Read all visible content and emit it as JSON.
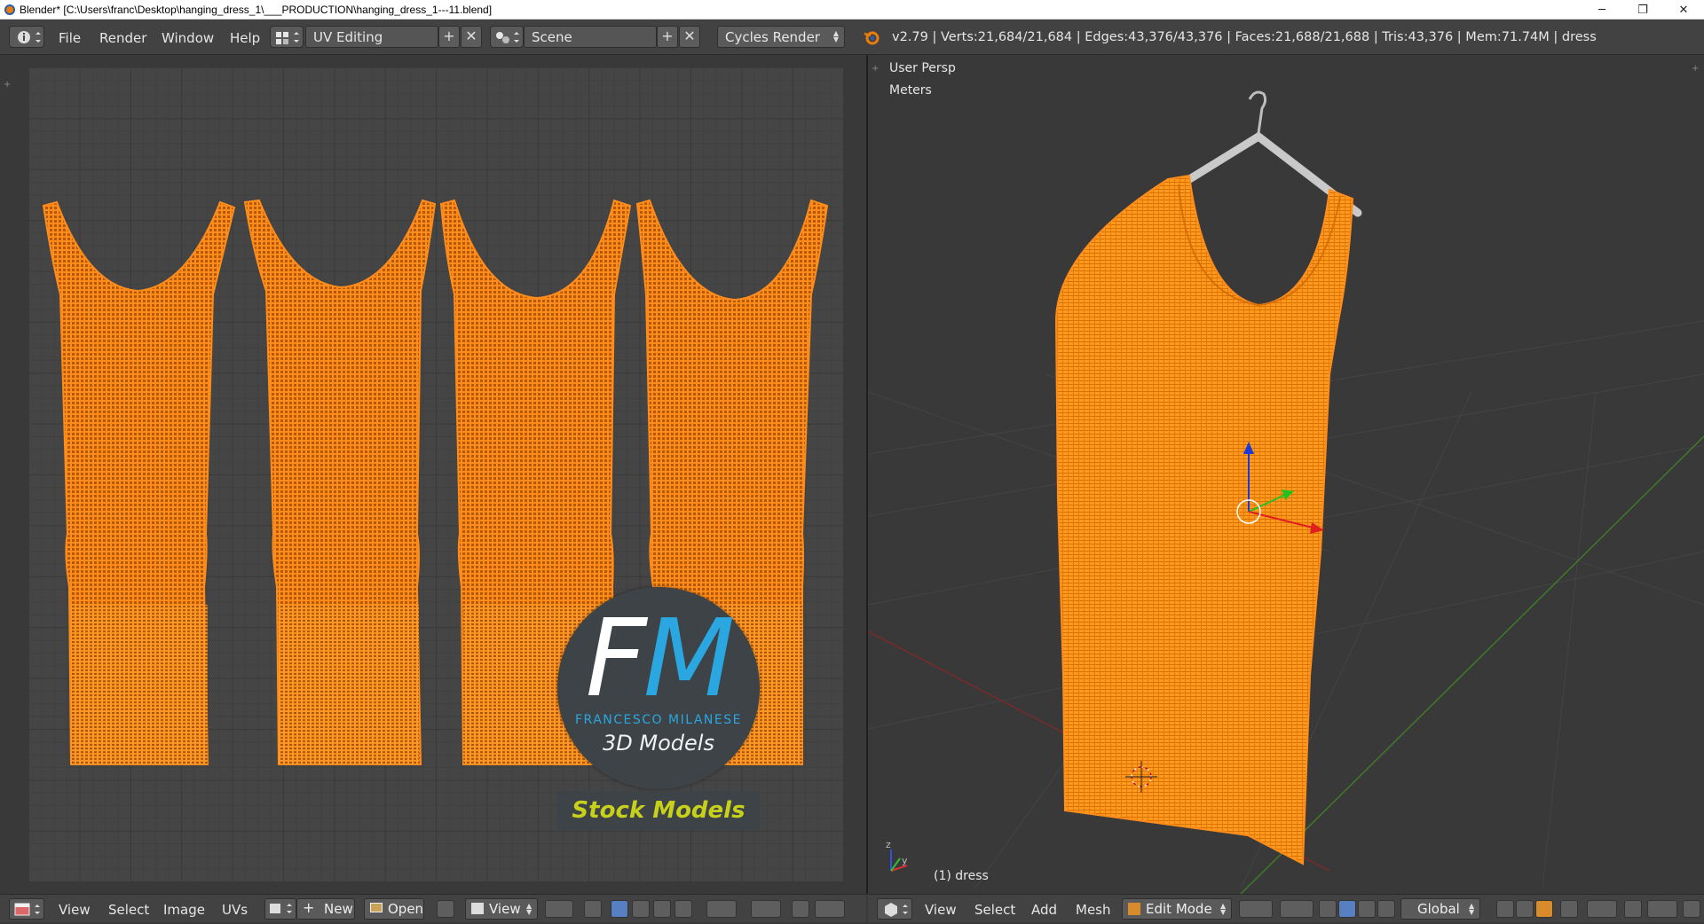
{
  "window": {
    "title": "Blender* [C:\\Users\\franc\\Desktop\\hanging_dress_1\\___PRODUCTION\\hanging_dress_1---11.blend]",
    "minimize": "─",
    "restore": "❐",
    "close": "✕"
  },
  "info_header": {
    "menus": [
      "File",
      "Render",
      "Window",
      "Help"
    ],
    "layout": "UV Editing",
    "scene": "Scene",
    "engine": "Cycles Render",
    "stats": "v2.79 | Verts:21,684/21,684 | Edges:43,376/43,376 | Faces:21,688/21,688 | Tris:43,376 | Mem:71.74M | dress"
  },
  "uv_editor": {
    "footer": {
      "menus": [
        "View",
        "Select",
        "Image",
        "UVs"
      ],
      "new_label": "New",
      "open_label": "Open",
      "view_label": "View"
    },
    "logo": {
      "letter_f": "F",
      "letter_m": "M",
      "name": "FRANCESCO MILANESE",
      "subtitle": "3D Models",
      "tagline": "Stock Models"
    }
  },
  "viewport": {
    "view_label": "User Persp",
    "units_label": "Meters",
    "object_label": "(1) dress",
    "footer": {
      "menus": [
        "View",
        "Select",
        "Add",
        "Mesh"
      ],
      "mode": "Edit Mode",
      "orientation": "Global"
    }
  },
  "colors": {
    "mesh_orange": "#ff8c1a",
    "header_bg": "#424242",
    "editor_bg": "#393939"
  }
}
